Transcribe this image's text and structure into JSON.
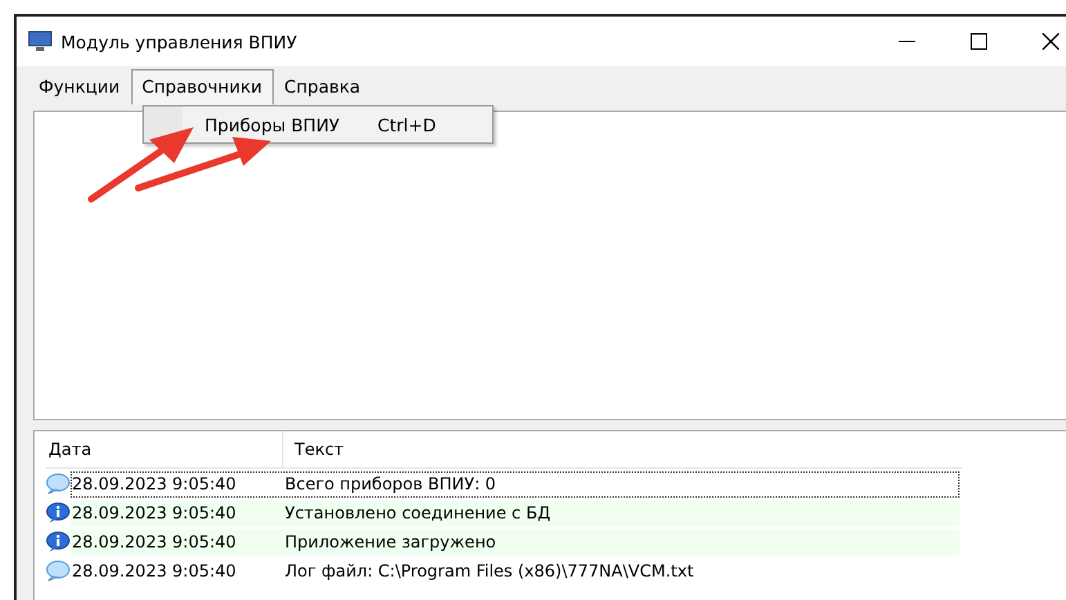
{
  "window": {
    "title": "Модуль управления ВПИУ"
  },
  "menu": [
    {
      "label": "Функции",
      "selected": false
    },
    {
      "label": "Справочники",
      "selected": true
    },
    {
      "label": "Справка",
      "selected": false
    }
  ],
  "dropdown": {
    "items": [
      {
        "label": "Приборы ВПИУ",
        "shortcut": "Ctrl+D"
      }
    ]
  },
  "log": {
    "columns": [
      "Дата",
      "Текст"
    ],
    "rows": [
      {
        "kind": "message",
        "date": "28.09.2023 9:05:40",
        "text": "Всего приборов ВПИУ: 0",
        "focused": true
      },
      {
        "kind": "info",
        "date": "28.09.2023 9:05:40",
        "text": "Установлено соединение с БД",
        "focused": false
      },
      {
        "kind": "info",
        "date": "28.09.2023 9:05:40",
        "text": "Приложение загружено",
        "focused": false
      },
      {
        "kind": "message",
        "date": "28.09.2023 9:05:40",
        "text": "Лог файл: C:\\Program Files (x86)\\777NA\\VCM.txt",
        "focused": false
      }
    ]
  }
}
